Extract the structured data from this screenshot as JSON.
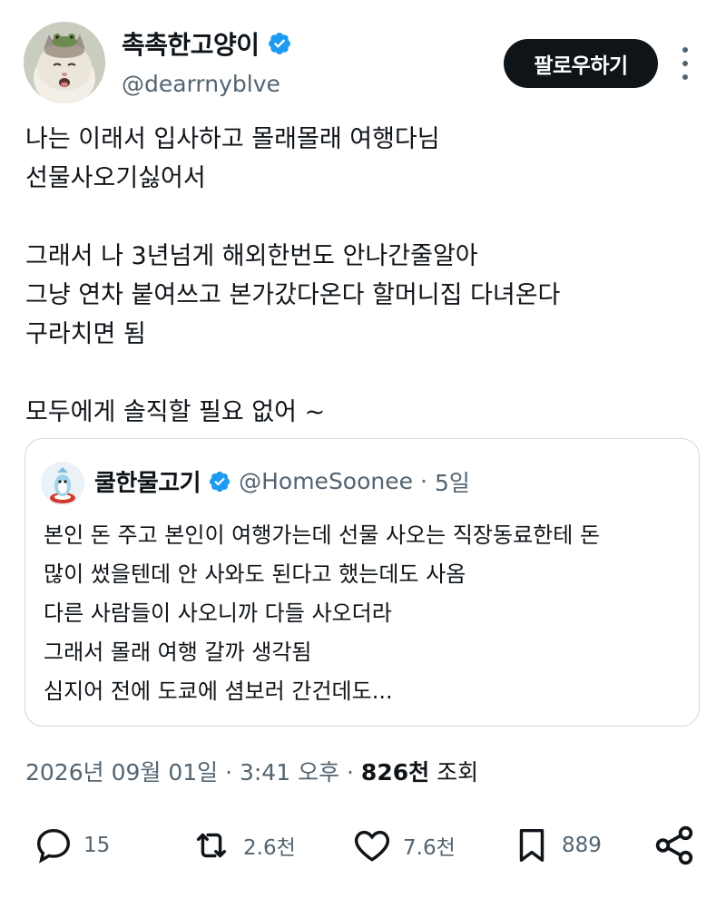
{
  "author": {
    "display_name": "촉촉한고양이",
    "handle": "@dearrnyblve",
    "verified_icon": "verified-badge-icon",
    "accent_color": "#1d9bf0"
  },
  "follow_label": "팔로우하기",
  "tweet_lines": [
    "나는 이래서 입사하고 몰래몰래 여행다님",
    "선물사오기싫어서",
    "",
    "그래서 나 3년넘게 해외한번도 안나간줄알아",
    "그냥 연차 붙여쓰고 본가갔다온다 할머니집 다녀온다",
    "구라치면 됨",
    "",
    "모두에게 솔직할 필요 없어 ~"
  ],
  "quote": {
    "display_name": "쿨한물고기",
    "handle": "@HomeSoonee",
    "separator": "·",
    "time": "5일",
    "lines": [
      "본인 돈 주고 본인이 여행가는데 선물 사오는 직장동료한테 돈",
      "많이 썼을텐데 안 사와도 된다고 했는데도 사옴",
      "다른 사람들이 사오니까 다들 사오더라",
      "그래서 몰래 여행 갈까 생각됨",
      "심지어 전에 도쿄에 셤보러 간건데도..."
    ]
  },
  "meta": {
    "datetime": "2026년 09월 01일 · 3:41 오후 · ",
    "views_count": "826천",
    "views_label": "조회"
  },
  "actions": {
    "replies": "15",
    "retweets": "2.6천",
    "likes": "7.6천",
    "bookmarks": "889"
  },
  "colors": {
    "text_primary": "#0f1419",
    "text_secondary": "#536471",
    "border": "#cfd9de",
    "button_bg": "#0f1419"
  }
}
